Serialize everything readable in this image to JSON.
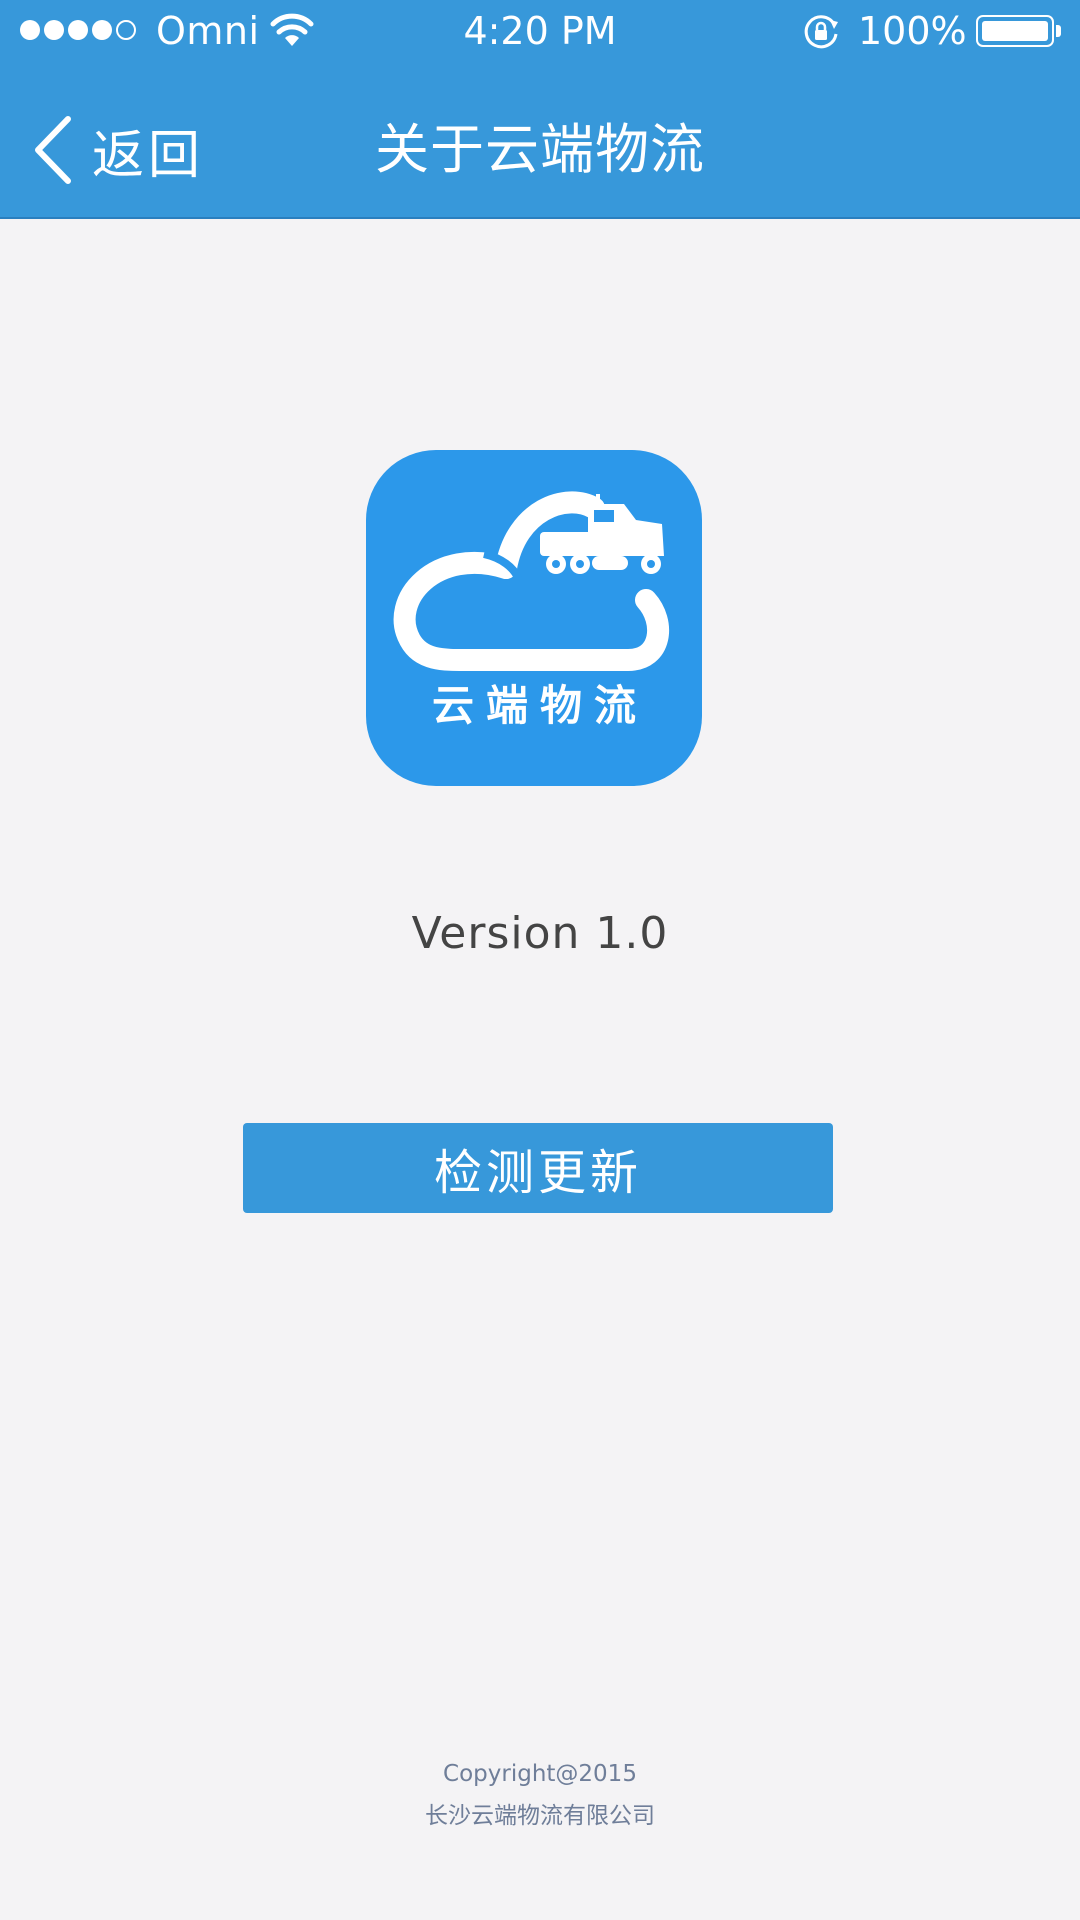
{
  "status_bar": {
    "carrier": "Omni",
    "time": "4:20 PM",
    "battery_percent": "100%",
    "signal_strength": "4 of 5 bars",
    "battery_level": 1.0
  },
  "nav": {
    "back_label": "返回",
    "title": "关于云端物流"
  },
  "app_icon": {
    "label": "云端物流",
    "icon": "cloud-truck-icon",
    "color": "#2c98ea"
  },
  "version": "Version 1.0",
  "update_button": {
    "label": "检测更新"
  },
  "footer": {
    "copyright": "Copyright@2015",
    "company": "长沙云端物流有限公司"
  },
  "colors": {
    "accent": "#3798da",
    "background": "#f4f3f5",
    "footer_text": "#6f7e99"
  }
}
